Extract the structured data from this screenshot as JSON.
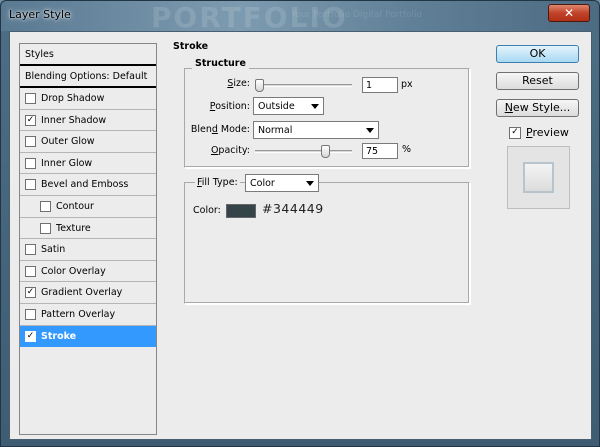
{
  "window": {
    "title": "Layer Style",
    "close_symbol": "✕",
    "watermark": "PORTFOLIO",
    "watermark_sub": "Your Portfolio Digital Portfolio"
  },
  "styles_list": {
    "header": "Styles",
    "blending_options": "Blending Options: Default",
    "items": [
      {
        "label": "Drop Shadow",
        "checked": false
      },
      {
        "label": "Inner Shadow",
        "checked": true
      },
      {
        "label": "Outer Glow",
        "checked": false
      },
      {
        "label": "Inner Glow",
        "checked": false
      },
      {
        "label": "Bevel and Emboss",
        "checked": false
      },
      {
        "label": "Contour",
        "checked": false,
        "sub": true
      },
      {
        "label": "Texture",
        "checked": false,
        "sub": true
      },
      {
        "label": "Satin",
        "checked": false
      },
      {
        "label": "Color Overlay",
        "checked": false
      },
      {
        "label": "Gradient Overlay",
        "checked": true
      },
      {
        "label": "Pattern Overlay",
        "checked": false
      },
      {
        "label": "Stroke",
        "checked": true,
        "selected": true
      }
    ]
  },
  "stroke": {
    "group_title": "Stroke",
    "structure": {
      "title": "Structure",
      "size": {
        "label_u": "S",
        "label_rest": "ize:",
        "value": "1",
        "unit": "px",
        "slider_fraction": 0.0
      },
      "position": {
        "label_u": "P",
        "label_rest": "osition:",
        "value": "Outside"
      },
      "blend_mode": {
        "label_pre": "Blen",
        "label_u": "d",
        "label_rest": " Mode:",
        "value": "Normal"
      },
      "opacity": {
        "label_u": "O",
        "label_rest": "pacity:",
        "value": "75",
        "unit": "%",
        "slider_fraction": 0.75
      }
    },
    "fill": {
      "fill_type": {
        "label_u": "F",
        "label_rest": "ill Type:",
        "value": "Color"
      },
      "color": {
        "label": "Color:",
        "hex_label": "#344449",
        "swatch": "#344449"
      }
    }
  },
  "buttons": {
    "ok": "OK",
    "reset": "Reset",
    "new_style_u": "N",
    "new_style_rest": "ew Style...",
    "preview": {
      "label_u": "P",
      "label_rest": "review",
      "checked": true
    }
  }
}
